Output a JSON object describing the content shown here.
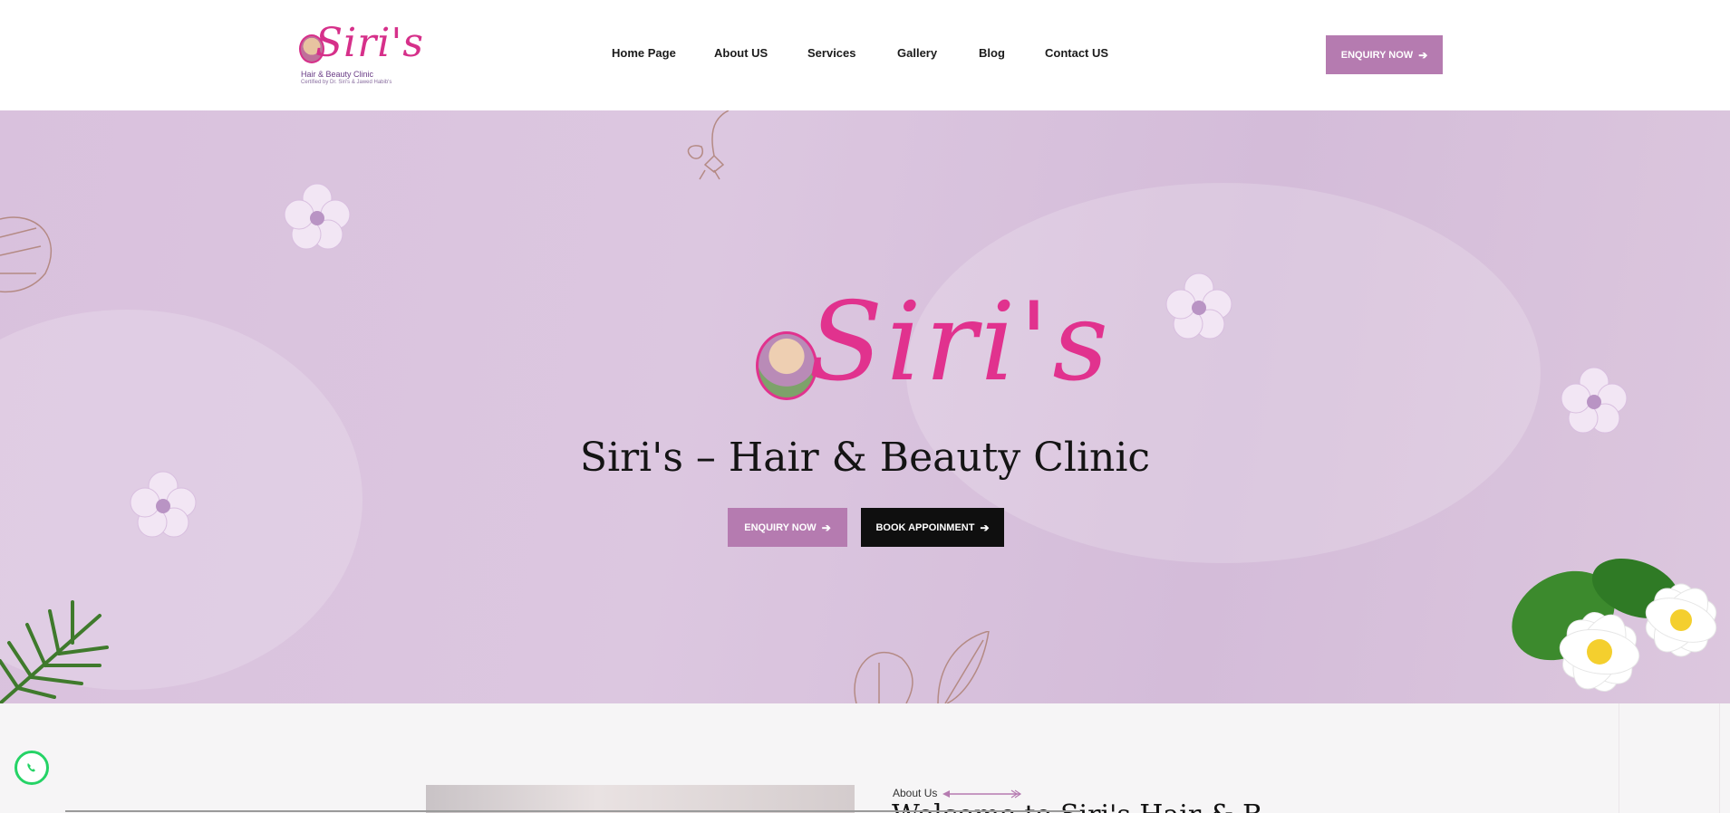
{
  "header": {
    "logo": {
      "wordmark": "Siri's",
      "subtitle": "Hair & Beauty Clinic",
      "tagline": "Certified by Dr. Siri's & Jawed Habib's"
    },
    "nav": [
      {
        "label": "Home Page"
      },
      {
        "label": "About US"
      },
      {
        "label": "Services"
      },
      {
        "label": "Gallery"
      },
      {
        "label": "Blog"
      },
      {
        "label": "Contact US"
      }
    ],
    "cta_label": "ENQUIRY NOW",
    "cta_icon": "arrow-right-icon"
  },
  "hero": {
    "logo_wordmark": "Siri's",
    "title": "Siri's – Hair & Beauty Clinic",
    "primary_button": "ENQUIRY NOW",
    "secondary_button": "BOOK APPOINMENT",
    "button_icon": "arrow-right-icon"
  },
  "about": {
    "label": "About Us",
    "heading_partial": "Welcome to Siri's Hair & B"
  },
  "floating": {
    "whatsapp_icon": "whatsapp-icon"
  },
  "colors": {
    "accent": "#b57bb0",
    "brand_pink": "#e1328e",
    "dark": "#0f0f0f",
    "hero_bg": "#dcc7e0"
  }
}
